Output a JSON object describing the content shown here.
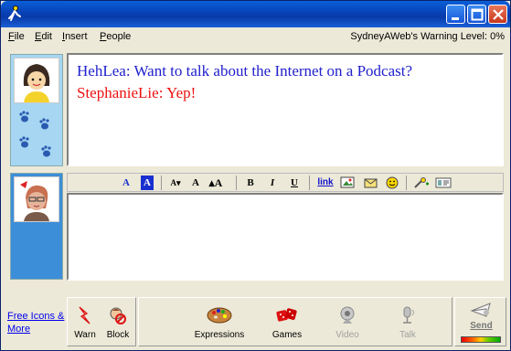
{
  "titlebar": {
    "title": ""
  },
  "menu": {
    "items": [
      "File",
      "Edit",
      "Insert",
      "People"
    ]
  },
  "warning_text": "SydneyAWeb's Warning Level: 0%",
  "conversation": [
    {
      "speaker": "HehLea",
      "message": "Want to talk about the Internet on a Podcast?",
      "color": "#2020cc"
    },
    {
      "speaker": "StephanieLie",
      "message": "Yep!",
      "color": "#ee1111"
    }
  ],
  "format_toolbar": {
    "items": [
      "A",
      "A",
      "A▾",
      "A",
      "▴A",
      "B",
      "I",
      "U",
      "link"
    ]
  },
  "input": {
    "value": ""
  },
  "free_icons_link": "Free Icons & More",
  "actions": [
    {
      "label": "Warn",
      "icon": "warn-icon"
    },
    {
      "label": "Block",
      "icon": "block-icon"
    }
  ],
  "features": [
    {
      "label": "Expressions",
      "icon": "palette-icon",
      "enabled": true
    },
    {
      "label": "Games",
      "icon": "dice-icon",
      "enabled": true
    },
    {
      "label": "Video",
      "icon": "webcam-icon",
      "enabled": false
    },
    {
      "label": "Talk",
      "icon": "microphone-icon",
      "enabled": false
    }
  ],
  "send_label": "Send"
}
